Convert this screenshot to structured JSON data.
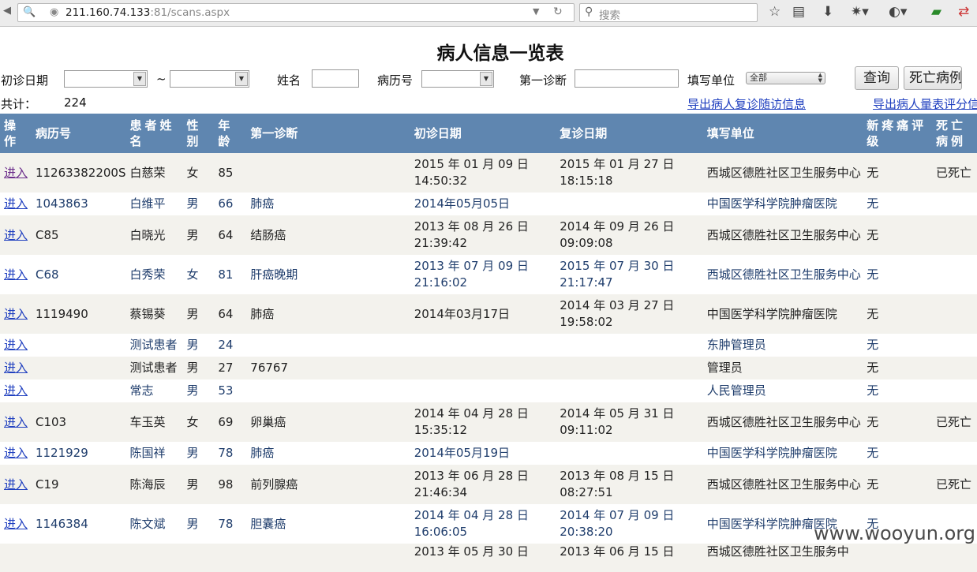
{
  "browser": {
    "url_host": "211.160.74.133",
    "url_rest": ":81/scans.aspx",
    "search_placeholder": "搜索"
  },
  "page": {
    "title": "病人信息一览表",
    "filters": {
      "first_visit_label": "初诊日期",
      "range_sep": "~",
      "name_label": "姓名",
      "record_no_label": "病历号",
      "diagnosis_label": "第一诊断",
      "unit_label": "填写单位",
      "unit_value": "全部"
    },
    "buttons": {
      "query": "查询",
      "death": "死亡病例"
    },
    "total_label": "共计：",
    "total_count": "224",
    "links": {
      "export_followup": "导出病人复诊随访信息",
      "export_scale": "导出病人量表评分信息"
    }
  },
  "table": {
    "headers": [
      "操作",
      "病历号",
      "患者姓名",
      "性别",
      "年龄",
      "第一诊断",
      "初诊日期",
      "复诊日期",
      "填写单位",
      "新疼痛评级",
      "死亡病例"
    ],
    "rows": [
      {
        "action": "进入",
        "record_no": "11263382200S",
        "name": "白慈荣",
        "sex": "女",
        "age": "85",
        "diagnosis": "",
        "first": "2015 年 01 月 09 日 14:50:32",
        "follow": "2015 年 01 月 27 日 18:15:18",
        "unit": "西城区德胜社区卫生服务中心",
        "pain": "无",
        "death": "已死亡"
      },
      {
        "action": "进入",
        "record_no": "1043863",
        "name": "白维平",
        "sex": "男",
        "age": "66",
        "diagnosis": "肺癌",
        "first": "2014年05月05日",
        "follow": "",
        "unit": "中国医学科学院肿瘤医院",
        "pain": "无",
        "death": ""
      },
      {
        "action": "进入",
        "record_no": "C85",
        "name": "白晓光",
        "sex": "男",
        "age": "64",
        "diagnosis": "结肠癌",
        "first": "2013 年 08 月 26 日 21:39:42",
        "follow": "2014 年 09 月 26 日 09:09:08",
        "unit": "西城区德胜社区卫生服务中心",
        "pain": "无",
        "death": ""
      },
      {
        "action": "进入",
        "record_no": "C68",
        "name": "白秀荣",
        "sex": "女",
        "age": "81",
        "diagnosis": "肝癌晚期",
        "first": "2013 年 07 月 09 日 21:16:02",
        "follow": "2015 年 07 月 30 日 21:17:47",
        "unit": "西城区德胜社区卫生服务中心",
        "pain": "无",
        "death": ""
      },
      {
        "action": "进入",
        "record_no": "1119490",
        "name": "蔡锡葵",
        "sex": "男",
        "age": "64",
        "diagnosis": "肺癌",
        "first": "2014年03月17日",
        "follow": "2014 年 03 月 27 日 19:58:02",
        "unit": "中国医学科学院肿瘤医院",
        "pain": "无",
        "death": ""
      },
      {
        "action": "进入",
        "record_no": "",
        "name": "测试患者",
        "sex": "男",
        "age": "24",
        "diagnosis": "",
        "first": "",
        "follow": "",
        "unit": "东肿管理员",
        "pain": "无",
        "death": ""
      },
      {
        "action": "进入",
        "record_no": "",
        "name": "测试患者",
        "sex": "男",
        "age": "27",
        "diagnosis": "76767",
        "first": "",
        "follow": "",
        "unit": "管理员",
        "pain": "无",
        "death": ""
      },
      {
        "action": "进入",
        "record_no": "",
        "name": "常志",
        "sex": "男",
        "age": "53",
        "diagnosis": "",
        "first": "",
        "follow": "",
        "unit": "人民管理员",
        "pain": "无",
        "death": ""
      },
      {
        "action": "进入",
        "record_no": "C103",
        "name": "车玉英",
        "sex": "女",
        "age": "69",
        "diagnosis": "卵巢癌",
        "first": "2014 年 04 月 28 日 15:35:12",
        "follow": "2014 年 05 月 31 日 09:11:02",
        "unit": "西城区德胜社区卫生服务中心",
        "pain": "无",
        "death": "已死亡"
      },
      {
        "action": "进入",
        "record_no": "1121929",
        "name": "陈国祥",
        "sex": "男",
        "age": "78",
        "diagnosis": "肺癌",
        "first": "2014年05月19日",
        "follow": "",
        "unit": "中国医学科学院肿瘤医院",
        "pain": "无",
        "death": ""
      },
      {
        "action": "进入",
        "record_no": "C19",
        "name": "陈海辰",
        "sex": "男",
        "age": "98",
        "diagnosis": "前列腺癌",
        "first": "2013 年 06 月 28 日 21:46:34",
        "follow": "2013 年 08 月 15 日 08:27:51",
        "unit": "西城区德胜社区卫生服务中心",
        "pain": "无",
        "death": "已死亡"
      },
      {
        "action": "进入",
        "record_no": "1146384",
        "name": "陈文斌",
        "sex": "男",
        "age": "78",
        "diagnosis": "胆囊癌",
        "first": "2014 年 04 月 28 日 16:06:05",
        "follow": "2014 年 07 月 09 日 20:38:20",
        "unit": "中国医学科学院肿瘤医院",
        "pain": "无",
        "death": ""
      },
      {
        "action": "",
        "record_no": "",
        "name": "",
        "sex": "",
        "age": "",
        "diagnosis": "",
        "first": "2013 年 05 月 30 日",
        "follow": "2013 年 06 月 15 日",
        "unit": "西城区德胜社区卫生服务中",
        "pain": "",
        "death": ""
      }
    ]
  },
  "watermark": "www.wooyun.org"
}
